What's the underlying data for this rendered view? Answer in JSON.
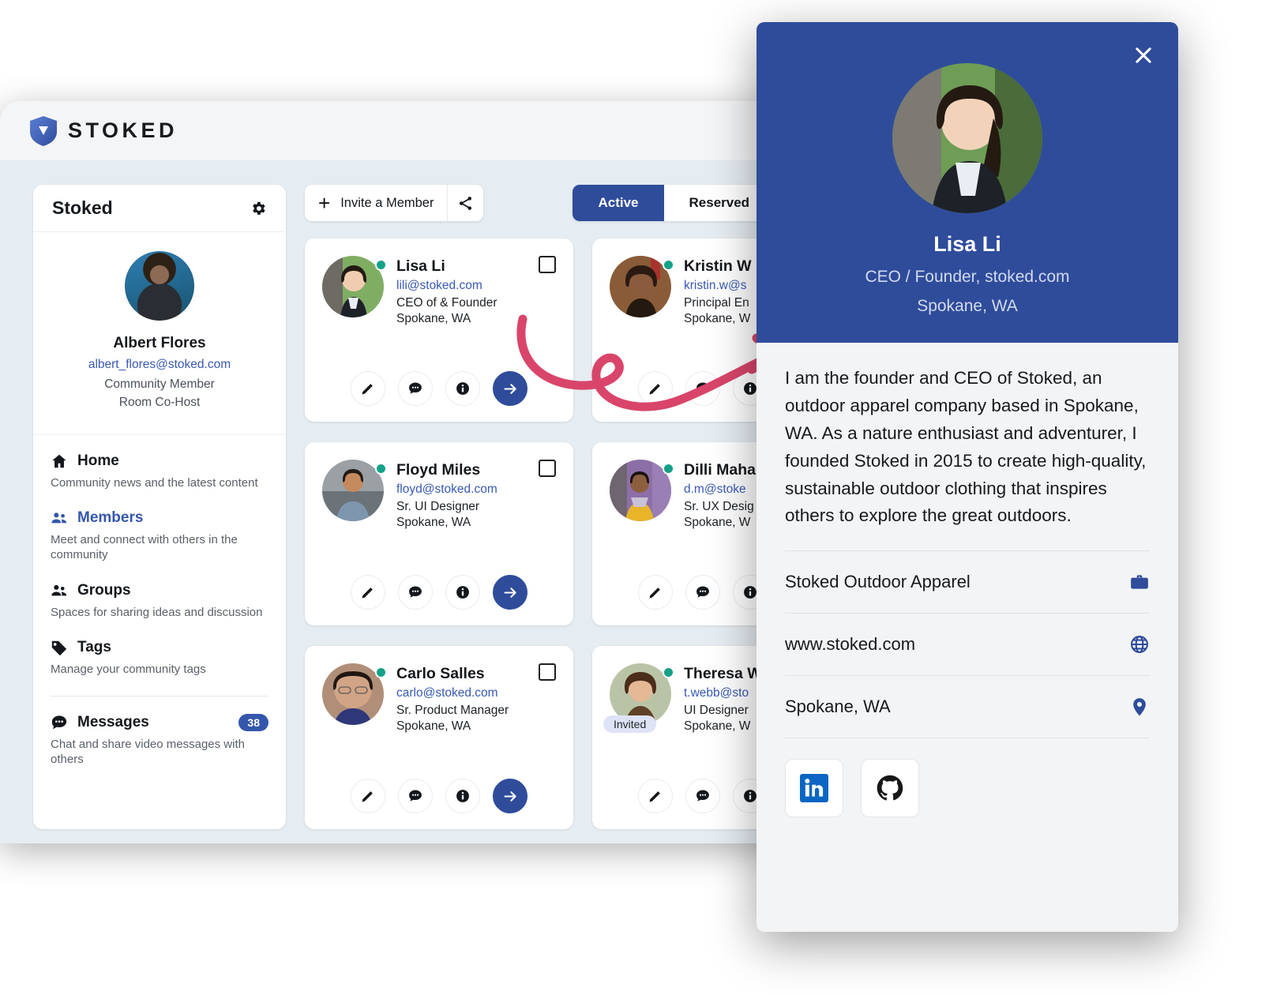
{
  "app": {
    "brand": "STOKED",
    "logo_icon": "shield-logo-icon"
  },
  "sidebar": {
    "title": "Stoked",
    "settings_icon": "gear-icon",
    "profile": {
      "avatar": "user-avatar",
      "name": "Albert Flores",
      "email": "albert_flores@stoked.com",
      "role": "Community Member",
      "role2": "Room Co-Host"
    },
    "nav": [
      {
        "icon": "home-icon",
        "label": "Home",
        "desc": "Community news and the latest content",
        "active": false
      },
      {
        "icon": "members-icon",
        "label": "Members",
        "desc": "Meet and connect with others in the community",
        "active": true
      },
      {
        "icon": "groups-icon",
        "label": "Groups",
        "desc": "Spaces for sharing ideas and discussion",
        "active": false
      },
      {
        "icon": "tag-icon",
        "label": "Tags",
        "desc": "Manage your community tags",
        "active": false
      }
    ],
    "messages": {
      "icon": "chat-icon",
      "label": "Messages",
      "badge": "38",
      "desc": "Chat and share video messages with others"
    }
  },
  "toolbar": {
    "plus_icon": "plus-icon",
    "invite_label": "Invite a Member",
    "share_icon": "share-icon",
    "tabs": [
      {
        "label": "Active",
        "selected": true
      },
      {
        "label": "Reserved",
        "selected": false
      }
    ]
  },
  "members": [
    {
      "name": "Lisa Li",
      "email": "lili@stoked.com",
      "role": "CEO of & Founder",
      "location": "Spokane, WA",
      "status": "online",
      "badge": ""
    },
    {
      "name": "Kristin W",
      "email": "kristin.w@s",
      "role": "Principal En",
      "location": "Spokane, W",
      "status": "online",
      "badge": ""
    },
    {
      "name": "Floyd Miles",
      "email": "floyd@stoked.com",
      "role": "Sr. UI Designer",
      "location": "Spokane, WA",
      "status": "online",
      "badge": ""
    },
    {
      "name": "Dilli Maha",
      "email": "d.m@stoke",
      "role": "Sr. UX Desig",
      "location": "Spokane, W",
      "status": "online",
      "badge": ""
    },
    {
      "name": "Carlo Salles",
      "email": "carlo@stoked.com",
      "role": "Sr. Product Manager",
      "location": "Spokane, WA",
      "status": "online",
      "badge": ""
    },
    {
      "name": "Theresa W",
      "email": "t.webb@sto",
      "role": "UI Designer",
      "location": "Spokane, W",
      "status": "online",
      "badge": "Invited"
    }
  ],
  "card_actions": {
    "edit_icon": "pencil-icon",
    "more_icon": "more-chat-icon",
    "info_icon": "info-icon",
    "go_icon": "arrow-right-icon"
  },
  "modal": {
    "close_icon": "close-icon",
    "avatar": "lisa-li-avatar",
    "name": "Lisa Li",
    "subtitle": "CEO / Founder, stoked.com",
    "location": "Spokane, WA",
    "bio": "I am the founder and CEO of Stoked, an outdoor apparel company based in Spokane, WA. As a nature enthusiast and adventurer, I founded Stoked in 2015 to create high-quality, sustainable outdoor clothing that inspires others to explore the great outdoors.",
    "rows": [
      {
        "text": "Stoked Outdoor Apparel",
        "icon": "briefcase-icon"
      },
      {
        "text": "www.stoked.com",
        "icon": "globe-icon"
      },
      {
        "text": "Spokane, WA",
        "icon": "map-pin-icon"
      }
    ],
    "social": [
      {
        "name": "linkedin-icon"
      },
      {
        "name": "github-icon"
      }
    ]
  },
  "annotation": {
    "shape": "pink-curved-arrow"
  },
  "colors": {
    "brand_blue": "#2F4C9B",
    "link_blue": "#3858B4",
    "status_green": "#15A188",
    "annotation_pink": "#D9456A",
    "app_bg": "#E6EDF2"
  }
}
